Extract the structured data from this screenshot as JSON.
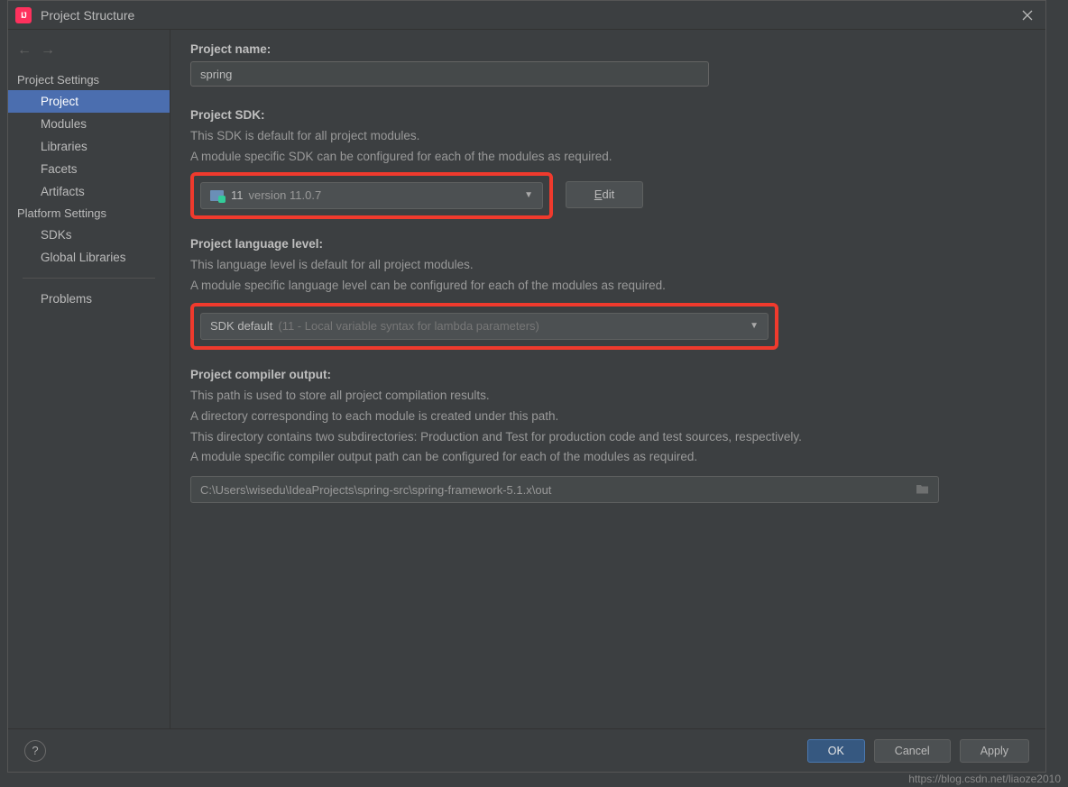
{
  "dialog": {
    "title": "Project Structure"
  },
  "sidebar": {
    "project_settings_heading": "Project Settings",
    "platform_settings_heading": "Platform Settings",
    "items": {
      "project": "Project",
      "modules": "Modules",
      "libraries": "Libraries",
      "facets": "Facets",
      "artifacts": "Artifacts",
      "sdks": "SDKs",
      "global_libraries": "Global Libraries",
      "problems": "Problems"
    }
  },
  "project": {
    "name_label": "Project name:",
    "name_value": "spring",
    "sdk_label": "Project SDK:",
    "sdk_desc1": "This SDK is default for all project modules.",
    "sdk_desc2": "A module specific SDK can be configured for each of the modules as required.",
    "sdk_selected_name": "11",
    "sdk_selected_version": "version 11.0.7",
    "edit_label": "Edit",
    "lang_label": "Project language level:",
    "lang_desc1": "This language level is default for all project modules.",
    "lang_desc2": "A module specific language level can be configured for each of the modules as required.",
    "lang_selected_main": "SDK default",
    "lang_selected_hint": "(11 - Local variable syntax for lambda parameters)",
    "out_label": "Project compiler output:",
    "out_desc1": "This path is used to store all project compilation results.",
    "out_desc2": "A directory corresponding to each module is created under this path.",
    "out_desc3": "This directory contains two subdirectories: Production and Test for production code and test sources, respectively.",
    "out_desc4": "A module specific compiler output path can be configured for each of the modules as required.",
    "out_value": "C:\\Users\\wisedu\\IdeaProjects\\spring-src\\spring-framework-5.1.x\\out"
  },
  "footer": {
    "ok": "OK",
    "cancel": "Cancel",
    "apply": "Apply"
  },
  "watermark": "https://blog.csdn.net/liaoze2010"
}
